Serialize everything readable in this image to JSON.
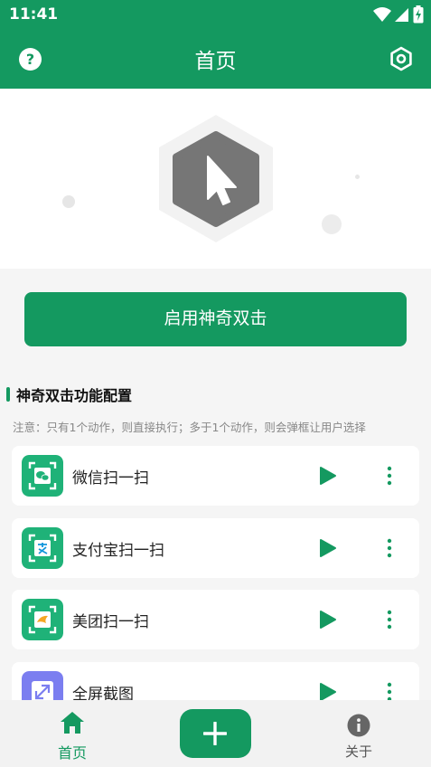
{
  "status": {
    "time": "11:41"
  },
  "appbar": {
    "title": "首页",
    "help_glyph": "?"
  },
  "primary_button": {
    "label": "启用神奇双击"
  },
  "section": {
    "title": "神奇双击功能配置",
    "note": "注意：只有1个动作，则直接执行；多于1个动作，则会弹框让用户选择"
  },
  "actions": [
    {
      "label": "微信扫一扫",
      "icon": "wechat-scan-icon",
      "color": "#1fb278"
    },
    {
      "label": "支付宝扫一扫",
      "icon": "alipay-scan-icon",
      "color": "#1fb278"
    },
    {
      "label": "美团扫一扫",
      "icon": "meituan-scan-icon",
      "color": "#1fb278"
    },
    {
      "label": "全屏截图",
      "icon": "fullscreen-screenshot-icon",
      "color": "#7b7ef0"
    }
  ],
  "bottom_nav": {
    "home_label": "首页",
    "about_label": "关于"
  },
  "colors": {
    "brand": "#149960",
    "play": "#149960"
  }
}
